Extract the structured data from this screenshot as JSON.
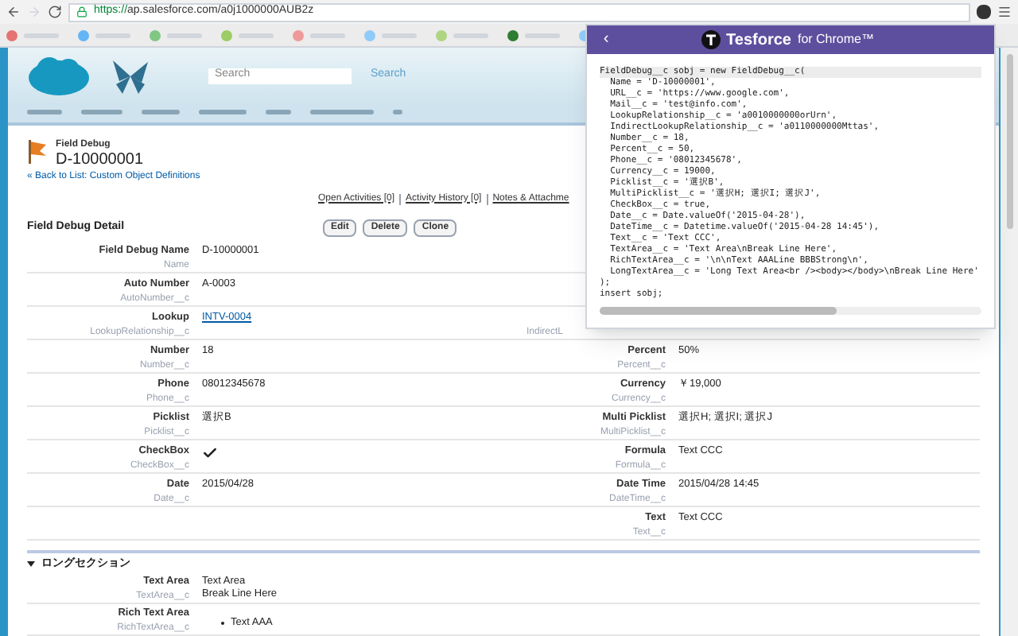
{
  "browser": {
    "url_scheme": "https://",
    "url_rest": "ap.salesforce.com/a0j1000000AUB2z"
  },
  "header": {
    "search_placeholder": "Search",
    "search_button": "Search"
  },
  "record": {
    "object": "Field Debug",
    "name": "D-10000001",
    "back_link": "« Back to List: Custom Object Definitions"
  },
  "related_links": [
    "Open Activities [0]",
    "Activity History [0]",
    "Notes & Attachme"
  ],
  "detail": {
    "title": "Field Debug Detail",
    "buttons": [
      "Edit",
      "Delete",
      "Clone"
    ],
    "rows": [
      {
        "left": {
          "label": "Field Debug Name",
          "api": "Name",
          "kind": "text",
          "value": "D-10000001"
        }
      },
      {
        "left": {
          "label": "Auto Number",
          "api": "AutoNumber__c",
          "kind": "text",
          "value": "A-0003"
        }
      },
      {
        "left": {
          "label": "Lookup",
          "api": "LookupRelationship__c",
          "kind": "link",
          "value": "INTV-0004"
        },
        "right": {
          "api": "IndirectL",
          "kind": "clipped"
        }
      },
      {
        "left": {
          "label": "Number",
          "api": "Number__c",
          "kind": "text",
          "value": "18"
        },
        "right": {
          "label": "Percent",
          "api": "Percent__c",
          "kind": "text",
          "value": "50%"
        }
      },
      {
        "left": {
          "label": "Phone",
          "api": "Phone__c",
          "kind": "text",
          "value": "08012345678"
        },
        "right": {
          "label": "Currency",
          "api": "Currency__c",
          "kind": "text",
          "value": "￥19,000"
        }
      },
      {
        "left": {
          "label": "Picklist",
          "api": "Picklist__c",
          "kind": "text",
          "value": "選択B"
        },
        "right": {
          "label": "Multi Picklist",
          "api": "MultiPicklist__c",
          "kind": "text",
          "value": "選択H; 選択I; 選択J"
        }
      },
      {
        "left": {
          "label": "CheckBox",
          "api": "CheckBox__c",
          "kind": "checkbox",
          "checked": true
        },
        "right": {
          "label": "Formula",
          "api": "Formula__c",
          "kind": "text",
          "value": "Text CCC"
        }
      },
      {
        "left": {
          "label": "Date",
          "api": "Date__c",
          "kind": "text",
          "value": "2015/04/28"
        },
        "right": {
          "label": "Date Time",
          "api": "DateTime__c",
          "kind": "text",
          "value": "2015/04/28 14:45"
        }
      },
      {
        "right": {
          "label": "Text",
          "api": "Text__c",
          "kind": "text",
          "value": "Text CCC"
        }
      }
    ]
  },
  "section": {
    "title": "ロングセクション",
    "expanded": true,
    "rows": [
      {
        "label": "Text Area",
        "api": "TextArea__c",
        "kind": "text",
        "value": "Text Area\nBreak Line Here"
      },
      {
        "label": "Rich Text Area",
        "api": "RichTextArea__c",
        "kind": "list",
        "items": [
          "Text AAA"
        ]
      }
    ]
  },
  "popup": {
    "back": "‹",
    "brand": "Tesforce",
    "suffix": "for Chrome™",
    "code": [
      {
        "text": "FieldDebug__c sobj = new FieldDebug__c(",
        "selected": true
      },
      {
        "text": "  Name = 'D-10000001',",
        "selected": false
      },
      {
        "text": "  URL__c = 'https://www.google.com',",
        "selected": false
      },
      {
        "text": "  Mail__c = 'test@info.com',",
        "selected": false
      },
      {
        "text": "  LookupRelationship__c = 'a0010000000orUrn',",
        "selected": false
      },
      {
        "text": "  IndirectLookupRelationship__c = 'a0110000000Mttas',",
        "selected": false
      },
      {
        "text": "  Number__c = 18,",
        "selected": false
      },
      {
        "text": "  Percent__c = 50,",
        "selected": false
      },
      {
        "text": "  Phone__c = '08012345678',",
        "selected": false
      },
      {
        "text": "  Currency__c = 19000,",
        "selected": false
      },
      {
        "text": "  Picklist__c = '選択B',",
        "selected": false
      },
      {
        "text": "  MultiPicklist__c = '選択H; 選択I; 選択J',",
        "selected": false
      },
      {
        "text": "  CheckBox__c = true,",
        "selected": false
      },
      {
        "text": "  Date__c = Date.valueOf('2015-04-28'),",
        "selected": false
      },
      {
        "text": "  DateTime__c = Datetime.valueOf('2015-04-28 14:45'),",
        "selected": false
      },
      {
        "text": "  Text__c = 'Text CCC',",
        "selected": false
      },
      {
        "text": "  TextArea__c = 'Text Area\\nBreak Line Here',",
        "selected": false
      },
      {
        "text": "  RichTextArea__c = '\\n\\nText AAALine BBBStrong\\n',",
        "selected": false
      },
      {
        "text": "  LongTextArea__c = 'Long Text Area<br /><body></body>\\nBreak Line Here'",
        "selected": false
      },
      {
        "text": ");",
        "selected": false
      },
      {
        "text": "insert sobj;",
        "selected": false
      }
    ]
  }
}
